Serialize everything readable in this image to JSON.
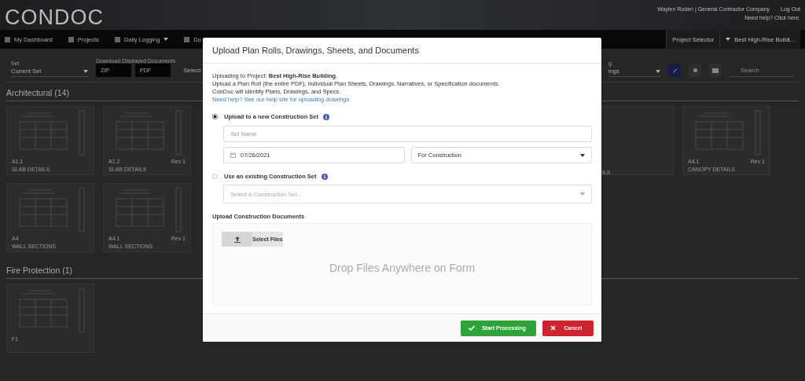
{
  "header": {
    "logo": "CONDOC",
    "user": "Waylen Roden | General Contractor Company",
    "logout": "Log Out",
    "help": "Need help? Click here."
  },
  "nav": {
    "items": [
      {
        "label": "My Dashboard",
        "dropdown": false
      },
      {
        "label": "Projects",
        "dropdown": false
      },
      {
        "label": "Daily Logging",
        "dropdown": true
      },
      {
        "label": "Do",
        "dropdown": false
      }
    ],
    "project_selector": "Project Selector",
    "project": "Best High-Rise Buildi..."
  },
  "toolbar": {
    "set_label": "Set",
    "set_value": "Current Set",
    "download_label": "Download Displayed Documents",
    "zip": "ZIP",
    "pdf": "PDF",
    "select_text": "Select",
    "right_label": "g",
    "right_value": "ings",
    "search_placeholder": "Search"
  },
  "sections": [
    {
      "title": "Architectural (14)",
      "rows": [
        [
          {
            "kind": "full",
            "code": "A1.1",
            "title": "SLAB DETAILS"
          },
          {
            "kind": "full",
            "code": "A1.2",
            "title": "SLAB DETAILS",
            "rev": "Rev 1"
          },
          {
            "kind": "partial",
            "title": "ILS"
          },
          {
            "kind": "full",
            "code": "A4.1",
            "title": "CANOPY DETAILS",
            "rev": "Rev 1"
          }
        ],
        [
          {
            "kind": "full",
            "code": "A4",
            "title": "WALL SECTIONS"
          },
          {
            "kind": "full",
            "code": "A4.1",
            "title": "WALL SECTIONS",
            "rev": "Rev 1"
          }
        ]
      ]
    },
    {
      "title": "Fire Protection (1)",
      "rows": [
        [
          {
            "kind": "full",
            "code": "F1"
          }
        ]
      ]
    }
  ],
  "modal": {
    "title": "Upload Plan Rolls, Drawings, Sheets, and Documents",
    "intro": [
      "Uploading to Project: **Best High-Rise Building**.",
      "Upload a Plan Roll (the entire PDF), individual Plan Sheets, Drawings, Narratives, or Specification documents.",
      "ConDoc will identify Plans, Drawings, and Specs."
    ],
    "help_link": "Need help? See our help site for uploading drawings",
    "options": [
      {
        "label": "Upload to a new Construction Set",
        "selected": true
      },
      {
        "label": "Use an existing Construction Set",
        "selected": false
      }
    ],
    "set_name": {
      "placeholder": "Set Name"
    },
    "date": "07/26/2021",
    "set_type": "For Construction",
    "existing_set": {
      "placeholder": "Select a Construction Set..."
    },
    "documents_label": "Upload Construction Documents",
    "select_files": "Select Files",
    "drop_hint": "Drop Files Anywhere on Form",
    "buttons": [
      {
        "kind": "primary",
        "label": "Start Processing"
      },
      {
        "kind": "danger",
        "label": "Cancel"
      }
    ]
  }
}
